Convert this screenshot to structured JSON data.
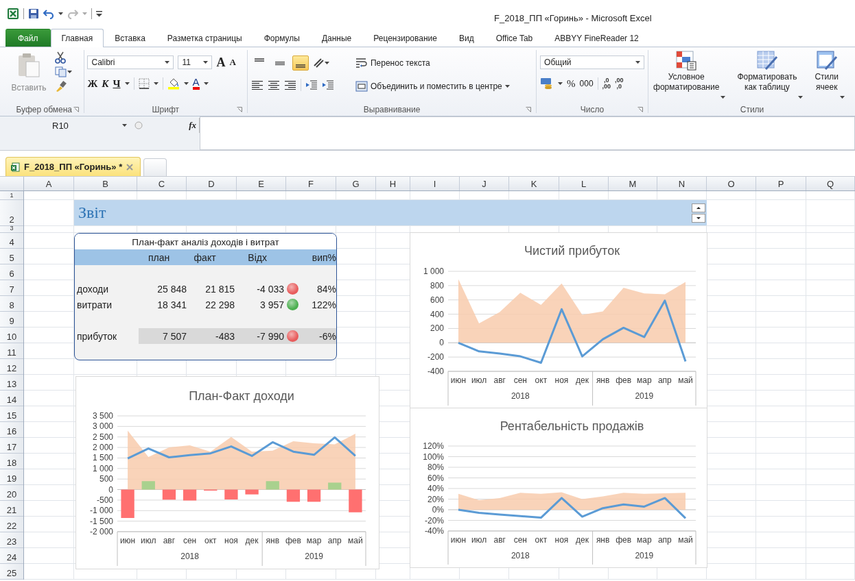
{
  "window": {
    "title": "F_2018_ПП «Горинь»  -  Microsoft Excel"
  },
  "ribbon_tabs": [
    {
      "label": "Файл",
      "kind": "file",
      "selected": false
    },
    {
      "label": "Главная",
      "kind": "tab",
      "selected": true
    },
    {
      "label": "Вставка",
      "kind": "tab",
      "selected": false
    },
    {
      "label": "Разметка страницы",
      "kind": "tab",
      "selected": false
    },
    {
      "label": "Формулы",
      "kind": "tab",
      "selected": false
    },
    {
      "label": "Данные",
      "kind": "tab",
      "selected": false
    },
    {
      "label": "Рецензирование",
      "kind": "tab",
      "selected": false
    },
    {
      "label": "Вид",
      "kind": "tab",
      "selected": false
    },
    {
      "label": "Office Tab",
      "kind": "tab",
      "selected": false
    },
    {
      "label": "ABBYY FineReader 12",
      "kind": "tab",
      "selected": false
    }
  ],
  "ribbon": {
    "clipboard": {
      "paste": "Вставить",
      "group": "Буфер обмена"
    },
    "font": {
      "family": "Calibri",
      "size": "11",
      "grow": "A",
      "shrink": "A",
      "bold": "Ж",
      "italic": "К",
      "underline": "Ч",
      "color_glyph": "A",
      "group": "Шрифт"
    },
    "alignment": {
      "vertical": [
        {
          "selected": false
        },
        {
          "selected": false
        },
        {
          "selected": true
        }
      ],
      "wrap": "Перенос текста",
      "merge": "Объединить и поместить в центре",
      "group": "Выравнивание"
    },
    "number": {
      "format": "Общий",
      "percent": "%",
      "thousands": "000",
      "increase_decimal": [
        ",0",
        ",00"
      ],
      "decrease_decimal": [
        ",00",
        ",0"
      ],
      "group": "Число"
    },
    "styles": {
      "buttons": [
        {
          "lines": [
            "Условное",
            "форматирование"
          ]
        },
        {
          "lines": [
            "Форматировать",
            "как таблицу"
          ]
        },
        {
          "lines": [
            "Стили",
            "ячеек"
          ]
        }
      ],
      "group": "Стили"
    }
  },
  "formula_bar": {
    "name_box": "R10",
    "function_label": "fx"
  },
  "document_tab": {
    "label": "F_2018_ПП «Горинь» *"
  },
  "columns": [
    "A",
    "B",
    "C",
    "D",
    "E",
    "F",
    "G",
    "H",
    "I",
    "J",
    "K",
    "L",
    "M",
    "N",
    "O",
    "P",
    "Q"
  ],
  "rows": [
    "1",
    "2",
    "3",
    "4",
    "5",
    "6",
    "7",
    "8",
    "9",
    "10",
    "11",
    "12",
    "13",
    "14",
    "15",
    "16",
    "17",
    "18",
    "19",
    "20",
    "21",
    "22",
    "23",
    "24",
    "25"
  ],
  "sheet": {
    "banner": "Звіт",
    "summary_table": {
      "title": "План-факт аналіз доходів і витрат",
      "headers": [
        "план",
        "факт",
        "Відх",
        "вип%"
      ],
      "rows": [
        {
          "label": "доходи",
          "plan": "25 848",
          "fact": "21 815",
          "deviation": "-4 033",
          "color": "#e85c5c",
          "percent": "84%",
          "shaded": false
        },
        {
          "label": "витрати",
          "plan": "18 341",
          "fact": "22 298",
          "deviation": "3 957",
          "color": "#4caf50",
          "percent": "122%",
          "shaded": false
        },
        {
          "label": "прибуток",
          "plan": "7 507",
          "fact": "-483",
          "deviation": "-7 990",
          "color": "#e85c5c",
          "percent": "-6%",
          "shaded": true
        }
      ]
    },
    "charts": [
      {
        "category_groups": [
          {
            "label": "2018"
          },
          {
            "label": "2019"
          }
        ],
        "chart_data": {
          "type": "line",
          "grid": true,
          "title": "План-Факт доходи",
          "categories": [
            "июн",
            "июл",
            "авг",
            "сен",
            "окт",
            "ноя",
            "дек",
            "янв",
            "фев",
            "мар",
            "апр",
            "май"
          ],
          "ylim": [
            -2000,
            3500
          ],
          "yticks": [
            {
              "value": 3500,
              "label": "3 500"
            },
            {
              "value": 3000,
              "label": "3 000"
            },
            {
              "value": 2500,
              "label": "2 500"
            },
            {
              "value": 2000,
              "label": "2 000"
            },
            {
              "value": 1500,
              "label": "1 500"
            },
            {
              "value": 1000,
              "label": "1 000"
            },
            500,
            0,
            -500,
            {
              "value": -1000,
              "label": "-1 000"
            },
            {
              "value": -1500,
              "label": "-1 500"
            },
            {
              "value": -2000,
              "label": "-2 000"
            }
          ],
          "series": [
            {
              "type": "area",
              "color": "#f8cbad",
              "values": [
                2800,
                1550,
                2000,
                2100,
                1800,
                2500,
                1800,
                1850,
                2300,
                2200,
                2150,
                2650
              ]
            },
            {
              "type": "bar",
              "color": "#ff7070",
              "values": [
                -1350,
                null,
                -480,
                -520,
                -50,
                -470,
                -230,
                null,
                -580,
                -580,
                null,
                -1080
              ]
            },
            {
              "type": "bar",
              "color": "#a9d18e",
              "values": [
                null,
                400,
                null,
                null,
                null,
                null,
                null,
                400,
                null,
                null,
                330,
                null
              ]
            },
            {
              "color": "#5b9bd5",
              "values": [
                1480,
                1950,
                1530,
                1640,
                1720,
                2050,
                1600,
                2250,
                1800,
                1650,
                2480,
                1600
              ]
            }
          ]
        }
      },
      {
        "category_groups": [
          {
            "label": "2018"
          },
          {
            "label": "2019"
          }
        ],
        "chart_data": {
          "type": "line",
          "grid": true,
          "title": "Чистий прибуток",
          "categories": [
            "июн",
            "июл",
            "авг",
            "сен",
            "окт",
            "ноя",
            "дек",
            "янв",
            "фев",
            "мар",
            "апр",
            "май"
          ],
          "ylim": [
            -400,
            1000
          ],
          "yticks": [
            {
              "value": 1000,
              "label": "1 000"
            },
            800,
            600,
            400,
            200,
            0,
            -200,
            -400
          ],
          "series": [
            {
              "type": "area",
              "color": "#f8cbad",
              "values": [
                890,
                270,
                430,
                700,
                530,
                830,
                390,
                440,
                770,
                690,
                680,
                850
              ]
            },
            {
              "color": "#5b9bd5",
              "values": [
                0,
                -120,
                -150,
                -190,
                -280,
                470,
                -190,
                50,
                210,
                80,
                590,
                -260
              ]
            }
          ]
        }
      },
      {
        "category_groups": [
          {
            "label": "2018"
          },
          {
            "label": "2019"
          }
        ],
        "chart_data": {
          "type": "line",
          "grid": true,
          "title": "Рентабельність продажів",
          "categories": [
            "июн",
            "июл",
            "авг",
            "сен",
            "окт",
            "ноя",
            "дек",
            "янв",
            "фев",
            "мар",
            "апр",
            "май"
          ],
          "ylim": [
            -40,
            120
          ],
          "yticks": [
            {
              "value": 120,
              "label": "120%"
            },
            {
              "value": 100,
              "label": "100%"
            },
            {
              "value": 80,
              "label": "80%"
            },
            {
              "value": 60,
              "label": "60%"
            },
            {
              "value": 40,
              "label": "40%"
            },
            {
              "value": 20,
              "label": "20%"
            },
            {
              "value": 0,
              "label": "0%"
            },
            {
              "value": -20,
              "label": "-20%"
            },
            {
              "value": -40,
              "label": "-40%"
            }
          ],
          "series": [
            {
              "type": "area",
              "color": "#f8cbad",
              "values": [
                30,
                18,
                22,
                32,
                30,
                33,
                20,
                25,
                32,
                30,
                31,
                32
              ]
            },
            {
              "color": "#5b9bd5",
              "values": [
                0,
                -6,
                -9,
                -12,
                -15,
                22,
                -13,
                3,
                10,
                6,
                22,
                -16
              ]
            }
          ]
        }
      }
    ]
  }
}
